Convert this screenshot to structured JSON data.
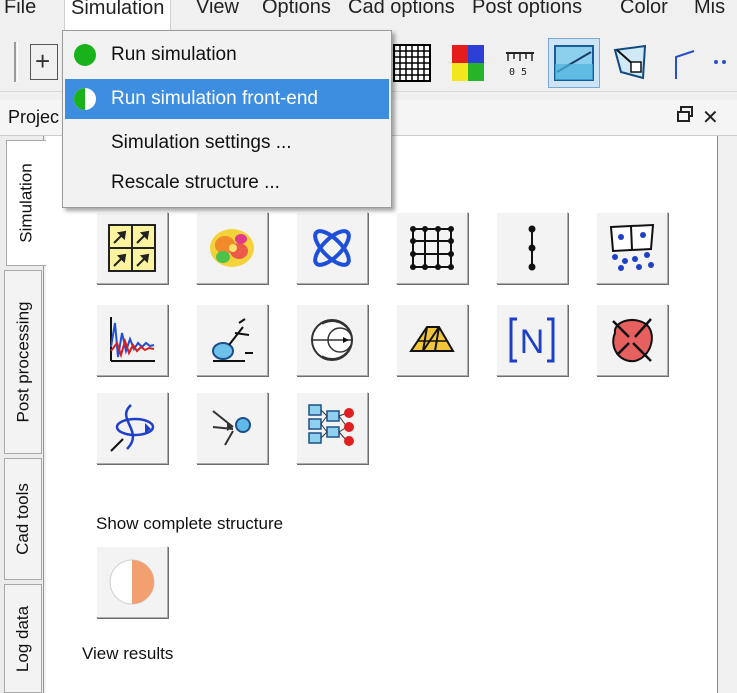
{
  "menubar": {
    "items": [
      "File",
      "Simulation",
      "View",
      "Options",
      "Cad options",
      "Post options",
      "Color",
      "Mis"
    ]
  },
  "panel": {
    "title": "Projec",
    "float_icon": "restore-window-icon",
    "close_glyph": "✕"
  },
  "side_tabs": [
    "Simulation",
    "Post processing",
    "Cad tools",
    "Log data"
  ],
  "simulation_menu": {
    "items": [
      {
        "label": "Run simulation",
        "icon": "green-circle-icon"
      },
      {
        "label": "Run simulation front-end",
        "icon": "green-half-circle-icon"
      },
      {
        "label": "Simulation settings ..."
      },
      {
        "label": "Rescale structure ..."
      }
    ]
  },
  "content": {
    "show_complete_label": "Show complete structure",
    "view_results_label": "View results",
    "tool_icons": [
      "quad-arrows-grid-icon",
      "field-blob-icon",
      "radiation-pattern-icon",
      "node-grid-icon",
      "vertical-dots-icon",
      "mesh-points-icon",
      "signal-plot-icon",
      "port-probe-icon",
      "smith-chart-icon",
      "truss-structure-icon",
      "matrix-n-icon",
      "absorbing-region-icon",
      "curve-rotation-icon",
      "network-arrows-icon",
      "neural-network-icon"
    ],
    "half-shade-icon": "half-shade-icon"
  },
  "toolbar": {
    "ruler_text": "0  5"
  },
  "colors": {
    "highlight": "#3d8ee0",
    "green": "#1ab21a",
    "panel_bg": "#ffffff"
  }
}
